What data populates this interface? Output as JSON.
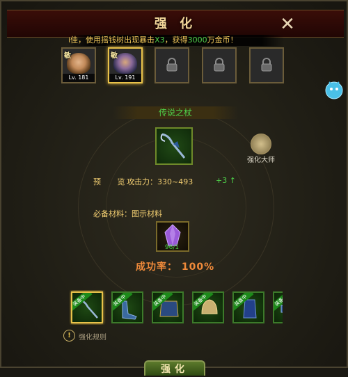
{
  "window": {
    "title": "强 化",
    "close_label": "✕"
  },
  "marquee": {
    "part1": "i佳，使用摇钱树出现暴击",
    "highlight1": "X3",
    "part2": "，获得",
    "highlight2": "3000",
    "part3": "万金币！"
  },
  "heroes": [
    {
      "tag": "敏",
      "level": "Lv. 181",
      "locked": false,
      "selected": false
    },
    {
      "tag": "敏",
      "level": "Lv. 191",
      "locked": false,
      "selected": true
    },
    {
      "locked": true
    },
    {
      "locked": true
    },
    {
      "locked": true
    }
  ],
  "item": {
    "name": "传说之杖"
  },
  "master": {
    "label": "强化大师"
  },
  "preview": {
    "label": "预  览：",
    "stat": "攻击力：330~493",
    "bonus": "+3 ↑"
  },
  "requirement": {
    "text": "必备材料：图示材料",
    "material_count": "96/1"
  },
  "success": {
    "text": "成功率： 100%"
  },
  "equipment": [
    {
      "badge": "装备中",
      "selected": true,
      "icon": "staff-icon"
    },
    {
      "badge": "装备中",
      "selected": false,
      "icon": "boots-icon"
    },
    {
      "badge": "装备中",
      "selected": false,
      "icon": "armor-icon"
    },
    {
      "badge": "装备中",
      "selected": false,
      "icon": "helmet-icon"
    },
    {
      "badge": "装备中",
      "selected": false,
      "icon": "gloves-icon"
    },
    {
      "badge": "装备中",
      "selected": false,
      "icon": "belt-icon"
    }
  ],
  "rules": {
    "icon_glyph": "!",
    "label": "强化规则"
  },
  "action": {
    "strengthen_label": "强化"
  }
}
